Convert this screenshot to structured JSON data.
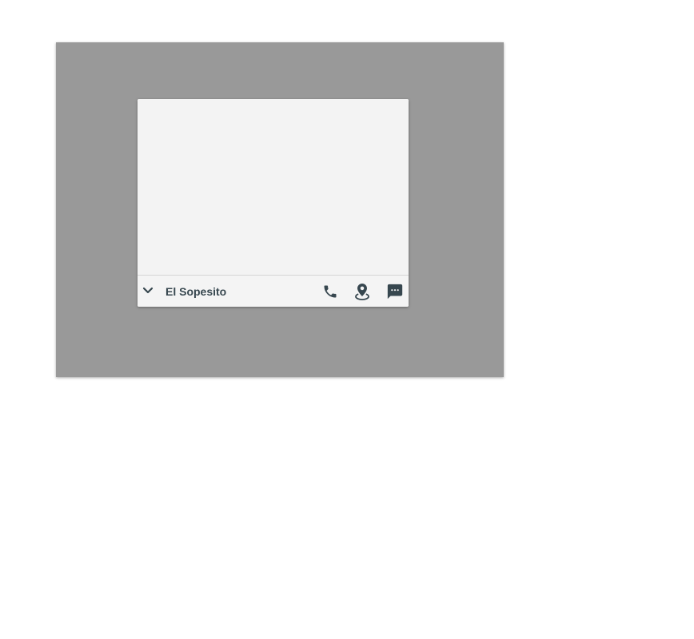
{
  "card": {
    "title": "El Sopesito"
  },
  "icons": {
    "collapse": "chevron-down-icon",
    "call": "phone-icon",
    "directions": "location-pin-icon",
    "message": "chat-bubble-icon"
  },
  "colors": {
    "backdrop": "#999999",
    "card_background": "#f3f3f3",
    "text": "#37474f",
    "icon": "#37474f"
  }
}
